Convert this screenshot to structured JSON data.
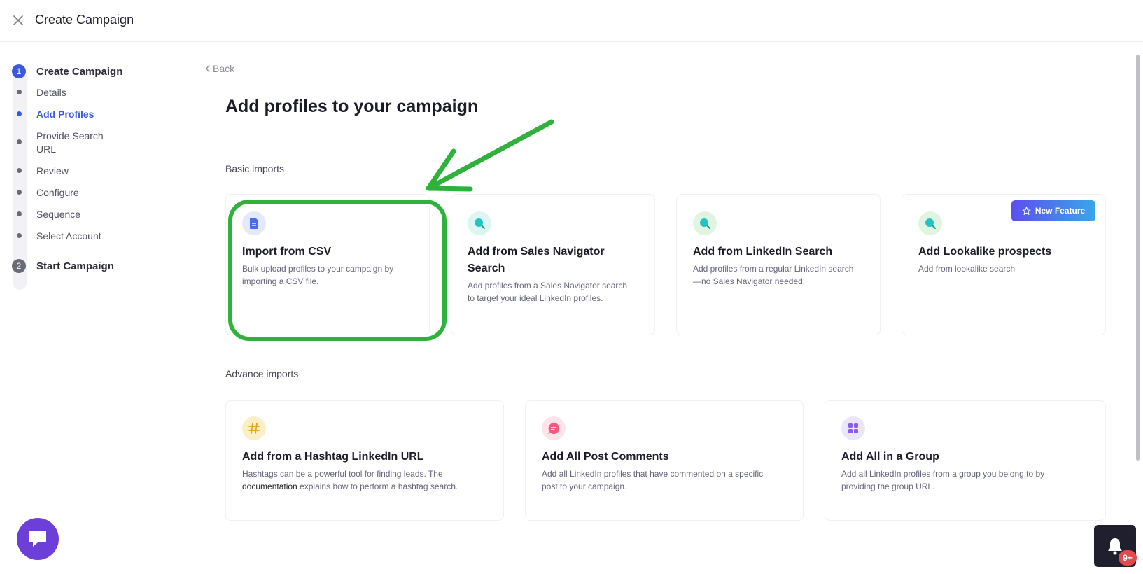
{
  "header": {
    "title": "Create Campaign",
    "close_icon": "close-icon"
  },
  "stepper": {
    "steps": [
      {
        "number": "1",
        "title": "Create Campaign",
        "state": "active"
      },
      {
        "number": "2",
        "title": "Start Campaign",
        "state": "inactive"
      }
    ],
    "sub_items": [
      {
        "label": "Details",
        "active": false
      },
      {
        "label": "Add Profiles",
        "active": true
      },
      {
        "label": "Provide Search URL",
        "active": false
      },
      {
        "label": "Review",
        "active": false
      },
      {
        "label": "Configure",
        "active": false
      },
      {
        "label": "Sequence",
        "active": false
      },
      {
        "label": "Select Account",
        "active": false
      }
    ]
  },
  "main": {
    "back_label": "Back",
    "title": "Add profiles to your campaign",
    "basic_label": "Basic imports",
    "advance_label": "Advance imports",
    "badge_label": "New Feature",
    "basic_cards": [
      {
        "title": "Import from CSV",
        "desc": "Bulk upload profiles to your campaign by importing a CSV file.",
        "icon": "csv-file-icon"
      },
      {
        "title": "Add from Sales Navigator Search",
        "desc": "Add profiles from a Sales Navigator search to target your ideal LinkedIn profiles.",
        "icon": "search-icon"
      },
      {
        "title": "Add from LinkedIn Search",
        "desc": "Add profiles from a regular LinkedIn search—no Sales Navigator needed!",
        "icon": "search-icon"
      },
      {
        "title": "Add Lookalike prospects",
        "desc": "Add from lookalike search",
        "icon": "search-icon"
      }
    ],
    "advance_cards": [
      {
        "title": "Add from a Hashtag LinkedIn URL",
        "desc_before": "Hashtags can be a powerful tool for finding leads. The",
        "desc_link": "documentation",
        "desc_after": "explains how to perform a hashtag search.",
        "icon": "hashtag-icon"
      },
      {
        "title": "Add All Post Comments",
        "desc": "Add all LinkedIn profiles that have commented on a specific post to your campaign.",
        "icon": "comment-icon"
      },
      {
        "title": "Add All in a Group",
        "desc": "Add all LinkedIn profiles from a group you belong to by providing the group URL.",
        "icon": "group-grid-icon"
      }
    ]
  },
  "notifications": {
    "count": "9+"
  },
  "colors": {
    "accent": "#3b5bdb",
    "highlight": "#2eb23c",
    "chat": "#6c3fd9"
  }
}
